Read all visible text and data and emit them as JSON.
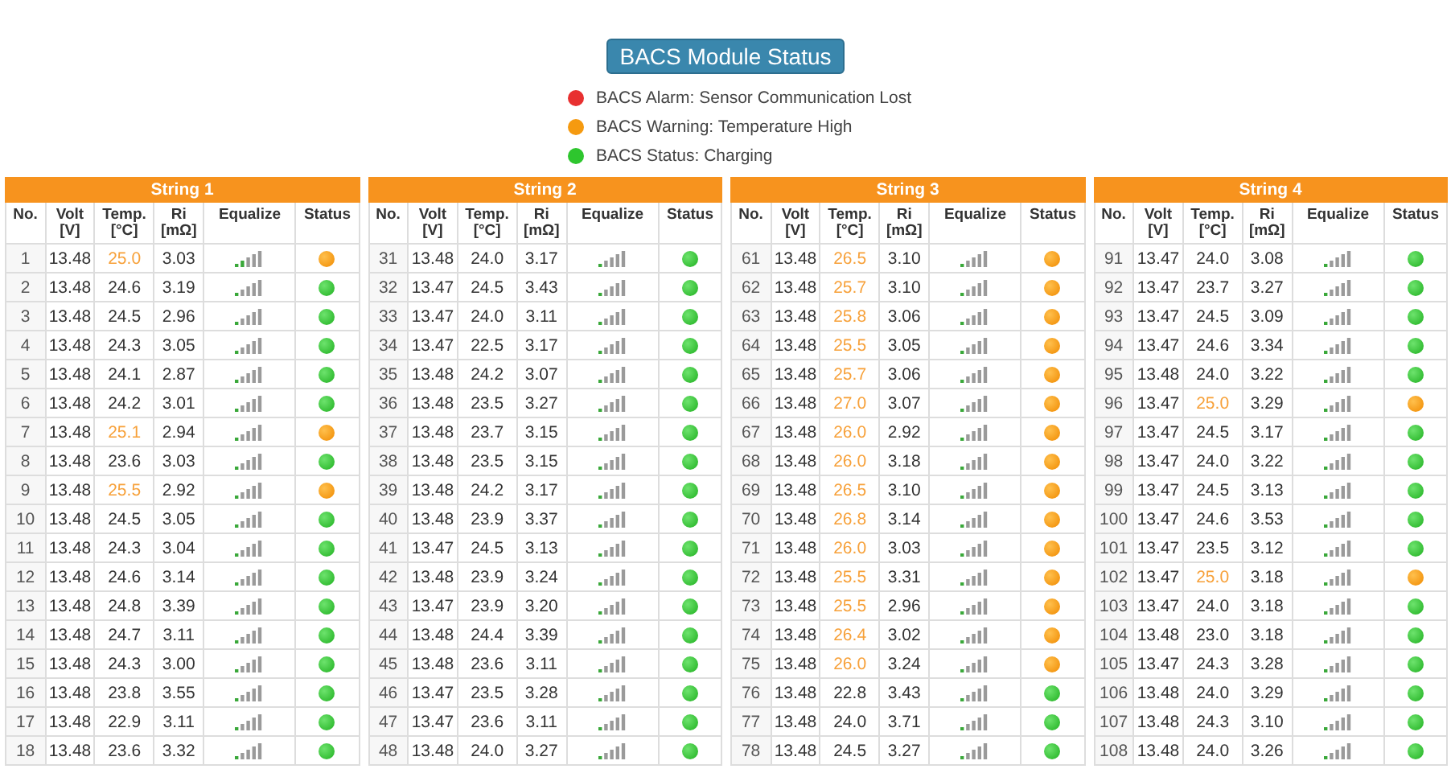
{
  "title": "BACS Module Status",
  "legend": [
    {
      "text": "BACS Alarm: Sensor Communication Lost",
      "color": "#e83030"
    },
    {
      "text": "BACS Warning: Temperature High",
      "color": "#f59a10"
    },
    {
      "text": "BACS Status: Charging",
      "color": "#2ec62e"
    }
  ],
  "strings": [
    {
      "title": "String 1",
      "columns": [
        "No.",
        "Volt [V]",
        "Temp. [°C]",
        "Ri [mΩ]",
        "Equalize",
        "Status"
      ],
      "rows": [
        {
          "no": "1",
          "volt": "13.48",
          "temp": "25.0",
          "ri": "3.03",
          "level": 0.4,
          "warning": true
        },
        {
          "no": "2",
          "volt": "13.48",
          "temp": "24.6",
          "ri": "3.19",
          "level": 0.2,
          "warning": false
        },
        {
          "no": "3",
          "volt": "13.48",
          "temp": "24.5",
          "ri": "2.96",
          "level": 0.2,
          "warning": false
        },
        {
          "no": "4",
          "volt": "13.48",
          "temp": "24.3",
          "ri": "3.05",
          "level": 0.2,
          "warning": false
        },
        {
          "no": "5",
          "volt": "13.48",
          "temp": "24.1",
          "ri": "2.87",
          "level": 0.2,
          "warning": false
        },
        {
          "no": "6",
          "volt": "13.48",
          "temp": "24.2",
          "ri": "3.01",
          "level": 0.2,
          "warning": false
        },
        {
          "no": "7",
          "volt": "13.48",
          "temp": "25.1",
          "ri": "2.94",
          "level": 0.2,
          "warning": true
        },
        {
          "no": "8",
          "volt": "13.48",
          "temp": "23.6",
          "ri": "3.03",
          "level": 0.2,
          "warning": false
        },
        {
          "no": "9",
          "volt": "13.48",
          "temp": "25.5",
          "ri": "2.92",
          "level": 0.2,
          "warning": true
        },
        {
          "no": "10",
          "volt": "13.48",
          "temp": "24.5",
          "ri": "3.05",
          "level": 0.2,
          "warning": false
        },
        {
          "no": "11",
          "volt": "13.48",
          "temp": "24.3",
          "ri": "3.04",
          "level": 0.2,
          "warning": false
        },
        {
          "no": "12",
          "volt": "13.48",
          "temp": "24.6",
          "ri": "3.14",
          "level": 0.2,
          "warning": false
        },
        {
          "no": "13",
          "volt": "13.48",
          "temp": "24.8",
          "ri": "3.39",
          "level": 0.2,
          "warning": false
        },
        {
          "no": "14",
          "volt": "13.48",
          "temp": "24.7",
          "ri": "3.11",
          "level": 0.2,
          "warning": false
        },
        {
          "no": "15",
          "volt": "13.48",
          "temp": "24.3",
          "ri": "3.00",
          "level": 0.2,
          "warning": false
        },
        {
          "no": "16",
          "volt": "13.48",
          "temp": "23.8",
          "ri": "3.55",
          "level": 0.2,
          "warning": false
        },
        {
          "no": "17",
          "volt": "13.48",
          "temp": "22.9",
          "ri": "3.11",
          "level": 0.2,
          "warning": false
        },
        {
          "no": "18",
          "volt": "13.48",
          "temp": "23.6",
          "ri": "3.32",
          "level": 0.2,
          "warning": false
        }
      ]
    },
    {
      "title": "String 2",
      "columns": [
        "No.",
        "Volt [V]",
        "Temp. [°C]",
        "Ri [mΩ]",
        "Equalize",
        "Status"
      ],
      "rows": [
        {
          "no": "31",
          "volt": "13.48",
          "temp": "24.0",
          "ri": "3.17",
          "level": 0.2,
          "warning": false
        },
        {
          "no": "32",
          "volt": "13.47",
          "temp": "24.5",
          "ri": "3.43",
          "level": 0.2,
          "warning": false
        },
        {
          "no": "33",
          "volt": "13.47",
          "temp": "24.0",
          "ri": "3.11",
          "level": 0.2,
          "warning": false
        },
        {
          "no": "34",
          "volt": "13.47",
          "temp": "22.5",
          "ri": "3.17",
          "level": 0.2,
          "warning": false
        },
        {
          "no": "35",
          "volt": "13.48",
          "temp": "24.2",
          "ri": "3.07",
          "level": 0.2,
          "warning": false
        },
        {
          "no": "36",
          "volt": "13.48",
          "temp": "23.5",
          "ri": "3.27",
          "level": 0.2,
          "warning": false
        },
        {
          "no": "37",
          "volt": "13.48",
          "temp": "23.7",
          "ri": "3.15",
          "level": 0.2,
          "warning": false
        },
        {
          "no": "38",
          "volt": "13.48",
          "temp": "23.5",
          "ri": "3.15",
          "level": 0.2,
          "warning": false
        },
        {
          "no": "39",
          "volt": "13.48",
          "temp": "24.2",
          "ri": "3.17",
          "level": 0.2,
          "warning": false
        },
        {
          "no": "40",
          "volt": "13.48",
          "temp": "23.9",
          "ri": "3.37",
          "level": 0.2,
          "warning": false
        },
        {
          "no": "41",
          "volt": "13.47",
          "temp": "24.5",
          "ri": "3.13",
          "level": 0.2,
          "warning": false
        },
        {
          "no": "42",
          "volt": "13.48",
          "temp": "23.9",
          "ri": "3.24",
          "level": 0.2,
          "warning": false
        },
        {
          "no": "43",
          "volt": "13.47",
          "temp": "23.9",
          "ri": "3.20",
          "level": 0.2,
          "warning": false
        },
        {
          "no": "44",
          "volt": "13.48",
          "temp": "24.4",
          "ri": "3.39",
          "level": 0.2,
          "warning": false
        },
        {
          "no": "45",
          "volt": "13.48",
          "temp": "23.6",
          "ri": "3.11",
          "level": 0.2,
          "warning": false
        },
        {
          "no": "46",
          "volt": "13.47",
          "temp": "23.5",
          "ri": "3.28",
          "level": 0.2,
          "warning": false
        },
        {
          "no": "47",
          "volt": "13.47",
          "temp": "23.6",
          "ri": "3.11",
          "level": 0.2,
          "warning": false
        },
        {
          "no": "48",
          "volt": "13.48",
          "temp": "24.0",
          "ri": "3.27",
          "level": 0.2,
          "warning": false
        }
      ]
    },
    {
      "title": "String 3",
      "columns": [
        "No.",
        "Volt [V]",
        "Temp. [°C]",
        "Ri [mΩ]",
        "Equalize",
        "Status"
      ],
      "rows": [
        {
          "no": "61",
          "volt": "13.48",
          "temp": "26.5",
          "ri": "3.10",
          "level": 0.2,
          "warning": true
        },
        {
          "no": "62",
          "volt": "13.48",
          "temp": "25.7",
          "ri": "3.10",
          "level": 0.2,
          "warning": true
        },
        {
          "no": "63",
          "volt": "13.48",
          "temp": "25.8",
          "ri": "3.06",
          "level": 0.2,
          "warning": true
        },
        {
          "no": "64",
          "volt": "13.48",
          "temp": "25.5",
          "ri": "3.05",
          "level": 0.2,
          "warning": true
        },
        {
          "no": "65",
          "volt": "13.48",
          "temp": "25.7",
          "ri": "3.06",
          "level": 0.2,
          "warning": true
        },
        {
          "no": "66",
          "volt": "13.48",
          "temp": "27.0",
          "ri": "3.07",
          "level": 0.2,
          "warning": true
        },
        {
          "no": "67",
          "volt": "13.48",
          "temp": "26.0",
          "ri": "2.92",
          "level": 0.2,
          "warning": true
        },
        {
          "no": "68",
          "volt": "13.48",
          "temp": "26.0",
          "ri": "3.18",
          "level": 0.2,
          "warning": true
        },
        {
          "no": "69",
          "volt": "13.48",
          "temp": "26.5",
          "ri": "3.10",
          "level": 0.2,
          "warning": true
        },
        {
          "no": "70",
          "volt": "13.48",
          "temp": "26.8",
          "ri": "3.14",
          "level": 0.2,
          "warning": true
        },
        {
          "no": "71",
          "volt": "13.48",
          "temp": "26.0",
          "ri": "3.03",
          "level": 0.2,
          "warning": true
        },
        {
          "no": "72",
          "volt": "13.48",
          "temp": "25.5",
          "ri": "3.31",
          "level": 0.2,
          "warning": true
        },
        {
          "no": "73",
          "volt": "13.48",
          "temp": "25.5",
          "ri": "2.96",
          "level": 0.2,
          "warning": true
        },
        {
          "no": "74",
          "volt": "13.48",
          "temp": "26.4",
          "ri": "3.02",
          "level": 0.2,
          "warning": true
        },
        {
          "no": "75",
          "volt": "13.48",
          "temp": "26.0",
          "ri": "3.24",
          "level": 0.2,
          "warning": true
        },
        {
          "no": "76",
          "volt": "13.48",
          "temp": "22.8",
          "ri": "3.43",
          "level": 0.2,
          "warning": false
        },
        {
          "no": "77",
          "volt": "13.48",
          "temp": "24.0",
          "ri": "3.71",
          "level": 0.2,
          "warning": false
        },
        {
          "no": "78",
          "volt": "13.48",
          "temp": "24.5",
          "ri": "3.27",
          "level": 0.2,
          "warning": false
        }
      ]
    },
    {
      "title": "String 4",
      "columns": [
        "No.",
        "Volt [V]",
        "Temp. [°C]",
        "Ri [mΩ]",
        "Equalize",
        "Status"
      ],
      "rows": [
        {
          "no": "91",
          "volt": "13.47",
          "temp": "24.0",
          "ri": "3.08",
          "level": 0.2,
          "warning": false
        },
        {
          "no": "92",
          "volt": "13.47",
          "temp": "23.7",
          "ri": "3.27",
          "level": 0.2,
          "warning": false
        },
        {
          "no": "93",
          "volt": "13.47",
          "temp": "24.5",
          "ri": "3.09",
          "level": 0.2,
          "warning": false
        },
        {
          "no": "94",
          "volt": "13.47",
          "temp": "24.6",
          "ri": "3.34",
          "level": 0.2,
          "warning": false
        },
        {
          "no": "95",
          "volt": "13.48",
          "temp": "24.0",
          "ri": "3.22",
          "level": 0.2,
          "warning": false
        },
        {
          "no": "96",
          "volt": "13.47",
          "temp": "25.0",
          "ri": "3.29",
          "level": 0.2,
          "warning": true
        },
        {
          "no": "97",
          "volt": "13.47",
          "temp": "24.5",
          "ri": "3.17",
          "level": 0.2,
          "warning": false
        },
        {
          "no": "98",
          "volt": "13.47",
          "temp": "24.0",
          "ri": "3.22",
          "level": 0.2,
          "warning": false
        },
        {
          "no": "99",
          "volt": "13.47",
          "temp": "24.5",
          "ri": "3.13",
          "level": 0.2,
          "warning": false
        },
        {
          "no": "100",
          "volt": "13.47",
          "temp": "24.6",
          "ri": "3.53",
          "level": 0.2,
          "warning": false
        },
        {
          "no": "101",
          "volt": "13.47",
          "temp": "23.5",
          "ri": "3.12",
          "level": 0.2,
          "warning": false
        },
        {
          "no": "102",
          "volt": "13.47",
          "temp": "25.0",
          "ri": "3.18",
          "level": 0.2,
          "warning": true
        },
        {
          "no": "103",
          "volt": "13.47",
          "temp": "24.0",
          "ri": "3.18",
          "level": 0.2,
          "warning": false
        },
        {
          "no": "104",
          "volt": "13.48",
          "temp": "23.0",
          "ri": "3.18",
          "level": 0.2,
          "warning": false
        },
        {
          "no": "105",
          "volt": "13.47",
          "temp": "24.3",
          "ri": "3.28",
          "level": 0.2,
          "warning": false
        },
        {
          "no": "106",
          "volt": "13.48",
          "temp": "24.0",
          "ri": "3.29",
          "level": 0.2,
          "warning": false
        },
        {
          "no": "107",
          "volt": "13.48",
          "temp": "24.3",
          "ri": "3.10",
          "level": 0.2,
          "warning": false
        },
        {
          "no": "108",
          "volt": "13.48",
          "temp": "24.0",
          "ri": "3.26",
          "level": 0.2,
          "warning": false
        }
      ]
    }
  ]
}
